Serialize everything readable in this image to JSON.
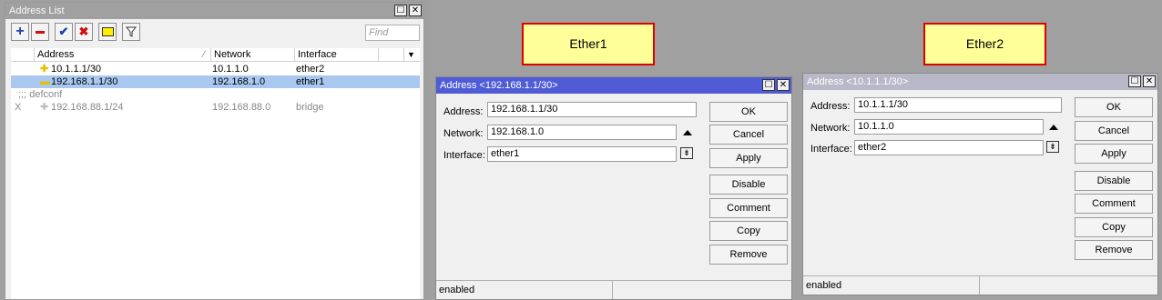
{
  "address_list": {
    "title": "Address List",
    "toolbar": {
      "add_icon": "plus-icon",
      "remove_icon": "minus-icon",
      "enable_icon": "check-icon",
      "disable_icon": "x-icon",
      "comment_icon": "note-icon",
      "filter_icon": "filter-icon",
      "find_placeholder": "Find"
    },
    "columns": [
      "Address",
      "Network",
      "Interface"
    ],
    "rows": [
      {
        "flag": "",
        "address": "10.1.1.1/30",
        "network": "10.1.1.0",
        "interface": "ether2",
        "selected": false,
        "disabled": false
      },
      {
        "flag": "",
        "address": "192.168.1.1/30",
        "network": "192.168.1.0",
        "interface": "ether1",
        "selected": true,
        "disabled": false
      },
      {
        "comment": ";;; defconf"
      },
      {
        "flag": "X",
        "address": "192.168.88.1/24",
        "network": "192.168.88.0",
        "interface": "bridge",
        "selected": false,
        "disabled": true
      }
    ]
  },
  "dialog1": {
    "title": "Address <192.168.1.1/30>",
    "annotation": "Ether1",
    "address_label": "Address:",
    "address": "192.168.1.1/30",
    "network_label": "Network:",
    "network": "192.168.1.0",
    "interface_label": "Interface:",
    "interface": "ether1",
    "buttons": [
      "OK",
      "Cancel",
      "Apply",
      "Disable",
      "Comment",
      "Copy",
      "Remove"
    ],
    "status": "enabled"
  },
  "dialog2": {
    "title": "Address <10.1.1.1/30>",
    "annotation": "Ether2",
    "address_label": "Address:",
    "address": "10.1.1.1/30",
    "network_label": "Network:",
    "network": "10.1.1.0",
    "interface_label": "Interface:",
    "interface": "ether2",
    "buttons": [
      "OK",
      "Cancel",
      "Apply",
      "Disable",
      "Comment",
      "Copy",
      "Remove"
    ],
    "status": "enabled"
  },
  "colors": {
    "selected_row": "#a8c8f0",
    "active_title": "#4f5cd6",
    "inactive_title": "#b8b8c8",
    "annotation_bg": "#ffff99",
    "annotation_border": "#e00000"
  }
}
